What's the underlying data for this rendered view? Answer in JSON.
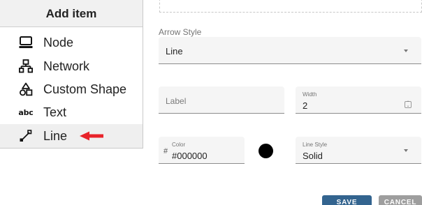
{
  "menu": {
    "title": "Add item",
    "items": [
      {
        "label": "Node",
        "icon": "computer-icon"
      },
      {
        "label": "Network",
        "icon": "network-icon"
      },
      {
        "label": "Custom Shape",
        "icon": "shapes-icon"
      },
      {
        "label": "Text",
        "icon": "text-abc-icon",
        "glyph": "abc"
      },
      {
        "label": "Line",
        "icon": "line-icon",
        "active": true
      }
    ],
    "pointer": "red-arrow-icon"
  },
  "form": {
    "arrow_style": {
      "label": "Arrow Style",
      "value": "Line"
    },
    "label_field": {
      "placeholder": "Label"
    },
    "width_field": {
      "label": "Width",
      "value": "2"
    },
    "color_field": {
      "label": "Color",
      "prefix": "#",
      "value": "#000000",
      "swatch": "#000000"
    },
    "line_style": {
      "label": "Line Style",
      "value": "Solid"
    }
  },
  "buttons": {
    "save": "SAVE",
    "cancel": "CANCEL"
  },
  "colors": {
    "save_button": "#33648f",
    "cancel_button": "#9e9e9e",
    "pointer_arrow": "#e8232a",
    "field_bg": "#f5f5f5"
  }
}
